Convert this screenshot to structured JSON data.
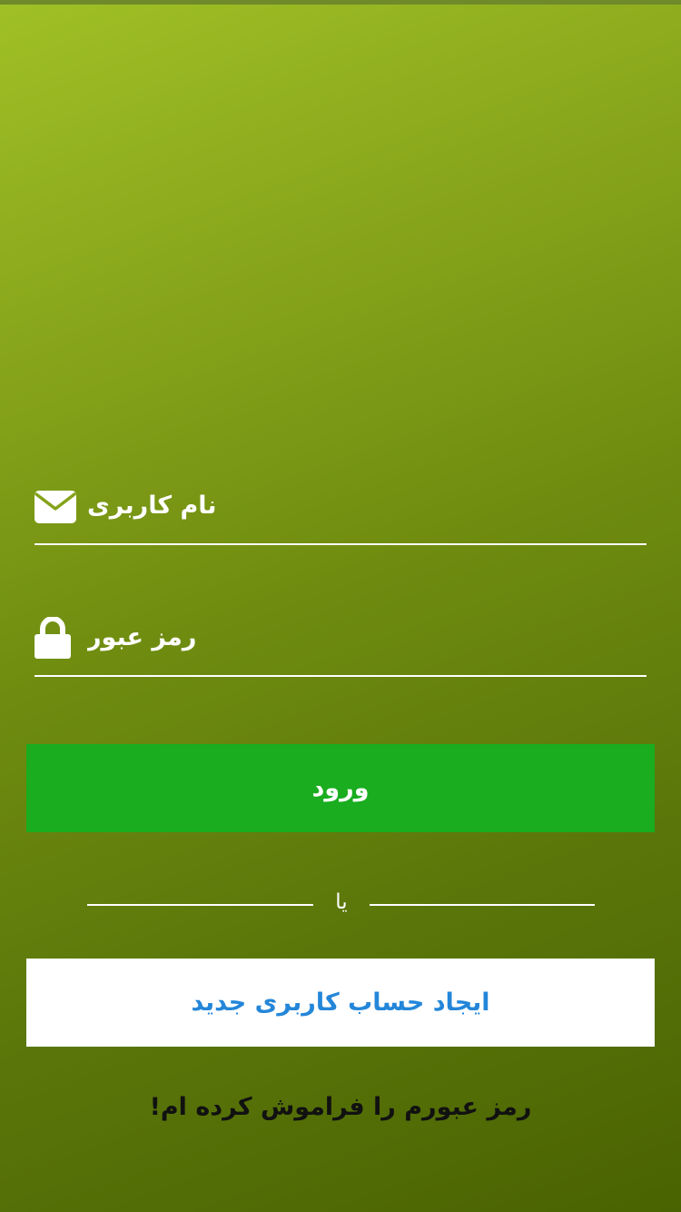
{
  "login_form": {
    "username": {
      "placeholder": "نام کاربری",
      "value": "",
      "icon": "envelope-icon"
    },
    "password": {
      "placeholder": "رمز عبور",
      "value": "",
      "icon": "lock-icon"
    },
    "login_label": "ورود",
    "divider_label": "یا",
    "signup_label": "ایجاد حساب کاربری جدید",
    "forgot_label": "رمز عبورم را فراموش کرده ام!"
  },
  "colors": {
    "background_top": "#a0c026",
    "background_bottom": "#4a6302",
    "login_button": "#19ad1f",
    "signup_button_bg": "#ffffff",
    "signup_text": "#2486d9",
    "forgot_text": "#111111"
  }
}
